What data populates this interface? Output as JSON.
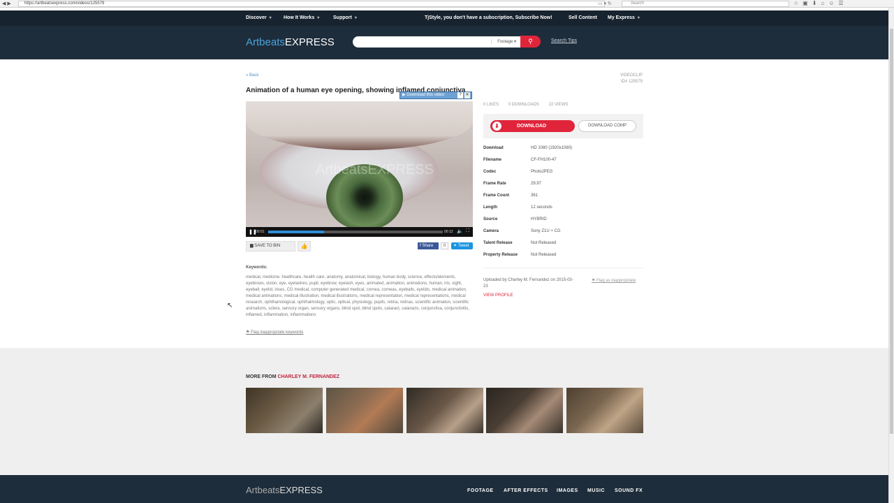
{
  "browser": {
    "url": "https://artbeatsexpress.com/videos/125579",
    "search_placeholder": "Search"
  },
  "topnav": {
    "discover": "Discover",
    "how_it_works": "How It Works",
    "support": "Support",
    "subscription_msg": "TjStyle, you don't have a subscription, Subscribe Now!",
    "sell_content": "Sell Content",
    "my_express": "My Express"
  },
  "logo": {
    "a": "Artbeats",
    "b": "EXPRESS"
  },
  "search": {
    "type": "Footage ▾",
    "tips": "Search Tips"
  },
  "page": {
    "back": "« Back",
    "type": "VIDEOCLIP",
    "id": "ID# 125579",
    "title": "Animation of a human eye opening, showing inflamed conjunctiva"
  },
  "player": {
    "watermark": "ArtbeatsEXPRESS",
    "download_badge": "Download this video",
    "current_time": "00:01",
    "duration": "00:12",
    "progress": 0.32
  },
  "actions": {
    "save_to_bin": "SAVE TO BIN",
    "fb_share": "Share",
    "fb_count": "0",
    "tweet": "Tweet"
  },
  "keywords": {
    "label": "Keywords:",
    "text": "medical, medicine, healthcare, health care, anatomy, anatomical, biology, human body, science, effects/elements, eyebrows, vision, eye, eyelashes, pupil, eyebrow, eyelash, eyes, animated, animation, animations, human, iris, sight, eyeball, eyelid, irises, CG medical, computer generated medical, cornea, corneas, eyeballs, eyelids, medical animation, medical animations, medical illustration, medical illustrations, medical representation, medical representations, medical research, ophthamological, ophthalmology, optic, optical, physiology, pupils, retina, retinas, scientific animation, scientific animations, sclera, sensory organ, sensory organs, blind spot, blind spots, cataract, cataracts, conjunctiva, conjunctivitis, inflamed, inflammation, inflammations",
    "flag": "Flag inappropriate keywords"
  },
  "stats": {
    "likes": "0 LIKES",
    "downloads": "0 DOWNLOADS",
    "views": "22 VIEWS"
  },
  "download": {
    "button": "DOWNLOAD",
    "comp": "DOWNLOAD COMP"
  },
  "specs": [
    {
      "k": "Download",
      "v": "HD 1080 (1920x1080)"
    },
    {
      "k": "Filename",
      "v": "CF-FH100-47"
    },
    {
      "k": "Codec",
      "v": "PhotoJPEG"
    },
    {
      "k": "Frame Rate",
      "v": "29.97"
    },
    {
      "k": "Frame Count",
      "v": "361"
    },
    {
      "k": "Length",
      "v": "12 seconds"
    },
    {
      "k": "Source",
      "v": "HYBRID"
    },
    {
      "k": "Camera",
      "v": "Sony Z1U + CG"
    },
    {
      "k": "Talent Release",
      "v": "Not Released"
    },
    {
      "k": "Property Release",
      "v": "Not Released"
    }
  ],
  "uploader": {
    "text": "Uploaded by Charley M. Fernandez on 2015-03-23",
    "flag": "Flag as inappropriate",
    "view_profile": "VIEW PROFILE"
  },
  "more": {
    "prefix": "MORE FROM",
    "name": "CHARLEY M. FERNANDEZ"
  },
  "footer": {
    "logo_a": "Artbeats",
    "logo_b": "EXPRESS",
    "nav": [
      "FOOTAGE",
      "AFTER EFFECTS",
      "IMAGES",
      "MUSIC",
      "SOUND FX"
    ]
  }
}
